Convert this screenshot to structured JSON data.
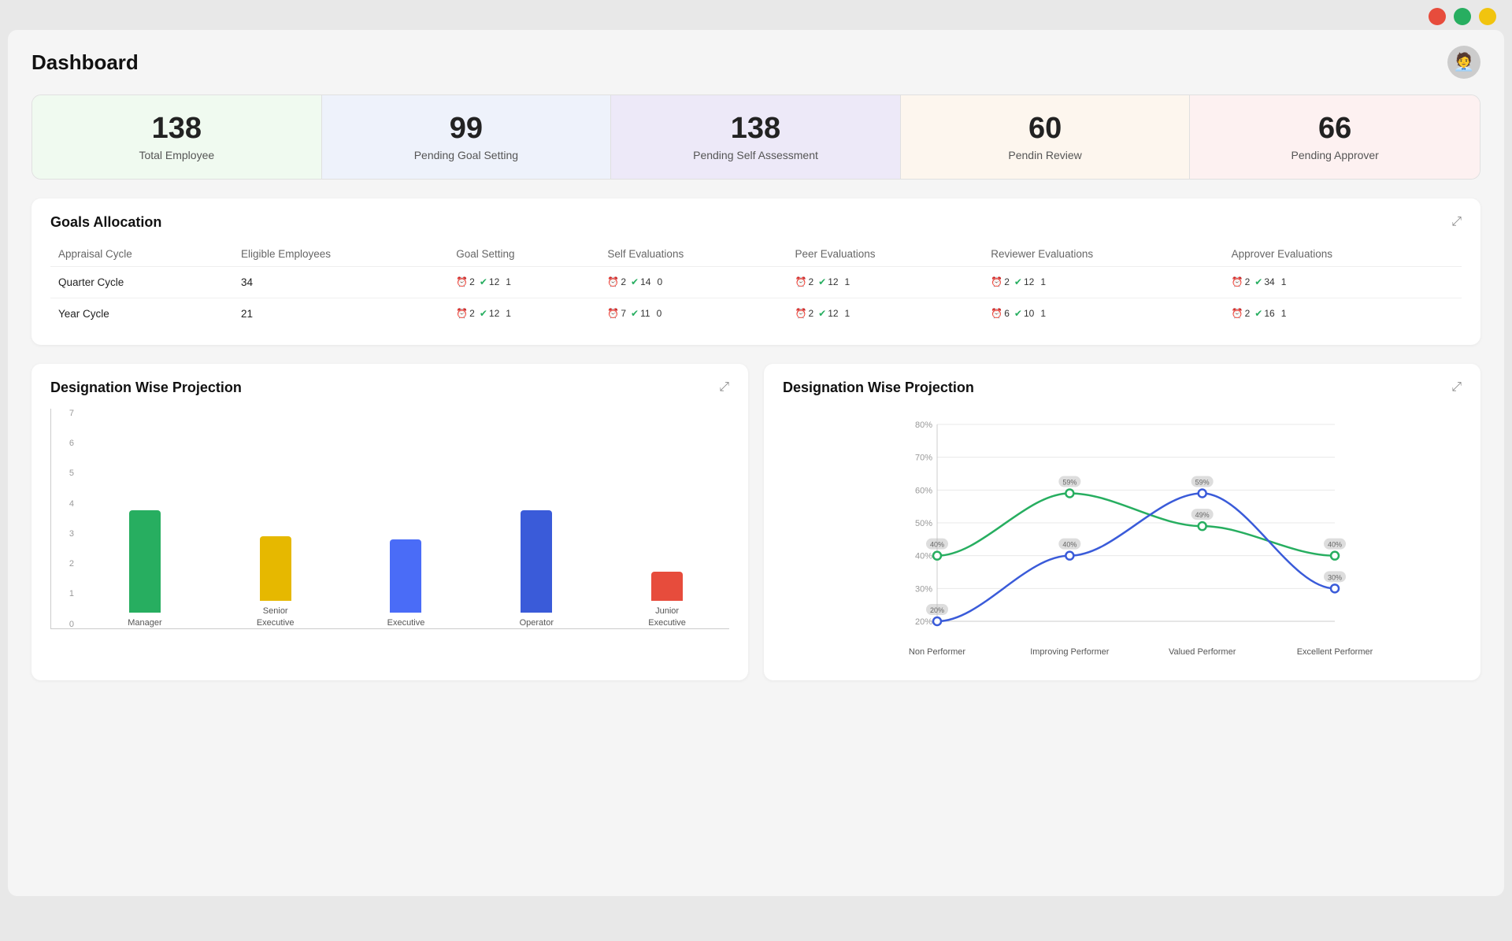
{
  "titleBar": {
    "trafficLights": [
      "#e74c3c",
      "#27ae60",
      "#f1c40f"
    ]
  },
  "header": {
    "title": "Dashboard",
    "avatarEmoji": "🧑‍💼"
  },
  "stats": [
    {
      "number": "138",
      "label": "Total Employee",
      "bgClass": "green-bg"
    },
    {
      "number": "99",
      "label": "Pending Goal Setting",
      "bgClass": "blue-bg"
    },
    {
      "number": "138",
      "label": "Pending Self Assessment",
      "bgClass": "purple-bg"
    },
    {
      "number": "60",
      "label": "Pendin Review",
      "bgClass": "orange-bg"
    },
    {
      "number": "66",
      "label": "Pending Approver",
      "bgClass": "pink-bg"
    }
  ],
  "goalsAllocation": {
    "title": "Goals Allocation",
    "columns": [
      "Appraisal Cycle",
      "Eligible Employees",
      "Goal Setting",
      "Self Evaluations",
      "Peer Evaluations",
      "Reviewer Evaluations",
      "Approver Evaluations"
    ],
    "rows": [
      {
        "cycle": "Quarter Cycle",
        "eligible": "34",
        "goalSetting": [
          {
            "icon": "⏰",
            "val": "2"
          },
          {
            "icon": "✔️",
            "val": "12"
          },
          {
            "icon": "⏰",
            "val": "1"
          }
        ],
        "selfEval": [
          {
            "icon": "⏰",
            "val": "2"
          },
          {
            "icon": "✔️",
            "val": "14"
          },
          {
            "icon": "⏰",
            "val": "0"
          }
        ],
        "peerEval": [
          {
            "icon": "⏰",
            "val": "2"
          },
          {
            "icon": "✔️",
            "val": "12"
          },
          {
            "icon": "⏰",
            "val": "1"
          }
        ],
        "reviewerEval": [
          {
            "icon": "⏰",
            "val": "2"
          },
          {
            "icon": "✔️",
            "val": "12"
          },
          {
            "icon": "⏰",
            "val": "1"
          }
        ],
        "approverEval": [
          {
            "icon": "⏰",
            "val": "2"
          },
          {
            "icon": "✔️",
            "val": "34"
          },
          {
            "icon": "⏰",
            "val": "1"
          }
        ]
      },
      {
        "cycle": "Year Cycle",
        "eligible": "21",
        "goalSetting": [
          {
            "icon": "⏰",
            "val": "2"
          },
          {
            "icon": "✔️",
            "val": "12"
          },
          {
            "icon": "⏰",
            "val": "1"
          }
        ],
        "selfEval": [
          {
            "icon": "⏰",
            "val": "7"
          },
          {
            "icon": "✔️",
            "val": "11"
          },
          {
            "icon": "⏰",
            "val": "0"
          }
        ],
        "peerEval": [
          {
            "icon": "⏰",
            "val": "2"
          },
          {
            "icon": "✔️",
            "val": "12"
          },
          {
            "icon": "⏰",
            "val": "1"
          }
        ],
        "reviewerEval": [
          {
            "icon": "⏰",
            "val": "6"
          },
          {
            "icon": "✔️",
            "val": "10"
          },
          {
            "icon": "⏰",
            "val": "1"
          }
        ],
        "approverEval": [
          {
            "icon": "⏰",
            "val": "2"
          },
          {
            "icon": "✔️",
            "val": "16"
          },
          {
            "icon": "⏰",
            "val": "1"
          }
        ]
      }
    ]
  },
  "barChart": {
    "title": "Designation Wise Projection",
    "yLabels": [
      "7",
      "6",
      "5",
      "4",
      "3",
      "2",
      "1",
      "0"
    ],
    "maxVal": 7,
    "bars": [
      {
        "label": "Manager",
        "value": 3.5,
        "color": "#27ae60"
      },
      {
        "label": "Senior\nExecutive",
        "value": 2.2,
        "color": "#e6b800"
      },
      {
        "label": "Executive",
        "value": 2.5,
        "color": "#4a6cf7"
      },
      {
        "label": "Operator",
        "value": 3.5,
        "color": "#3a5bd9"
      },
      {
        "label": "Junior\nExecutive",
        "value": 1.0,
        "color": "#e74c3c"
      }
    ]
  },
  "lineChart": {
    "title": "Designation Wise Projection",
    "yLabels": [
      "80%",
      "70%",
      "60%",
      "50%",
      "40%",
      "30%",
      "20%"
    ],
    "xLabels": [
      "Non Performer",
      "Improving Performer",
      "Valued Performer",
      "Excellent Performer"
    ],
    "series": [
      {
        "color": "#27ae60",
        "points": [
          40,
          59,
          49,
          40
        ]
      },
      {
        "color": "#3a5bd9",
        "points": [
          20,
          40,
          59,
          30
        ]
      }
    ]
  }
}
